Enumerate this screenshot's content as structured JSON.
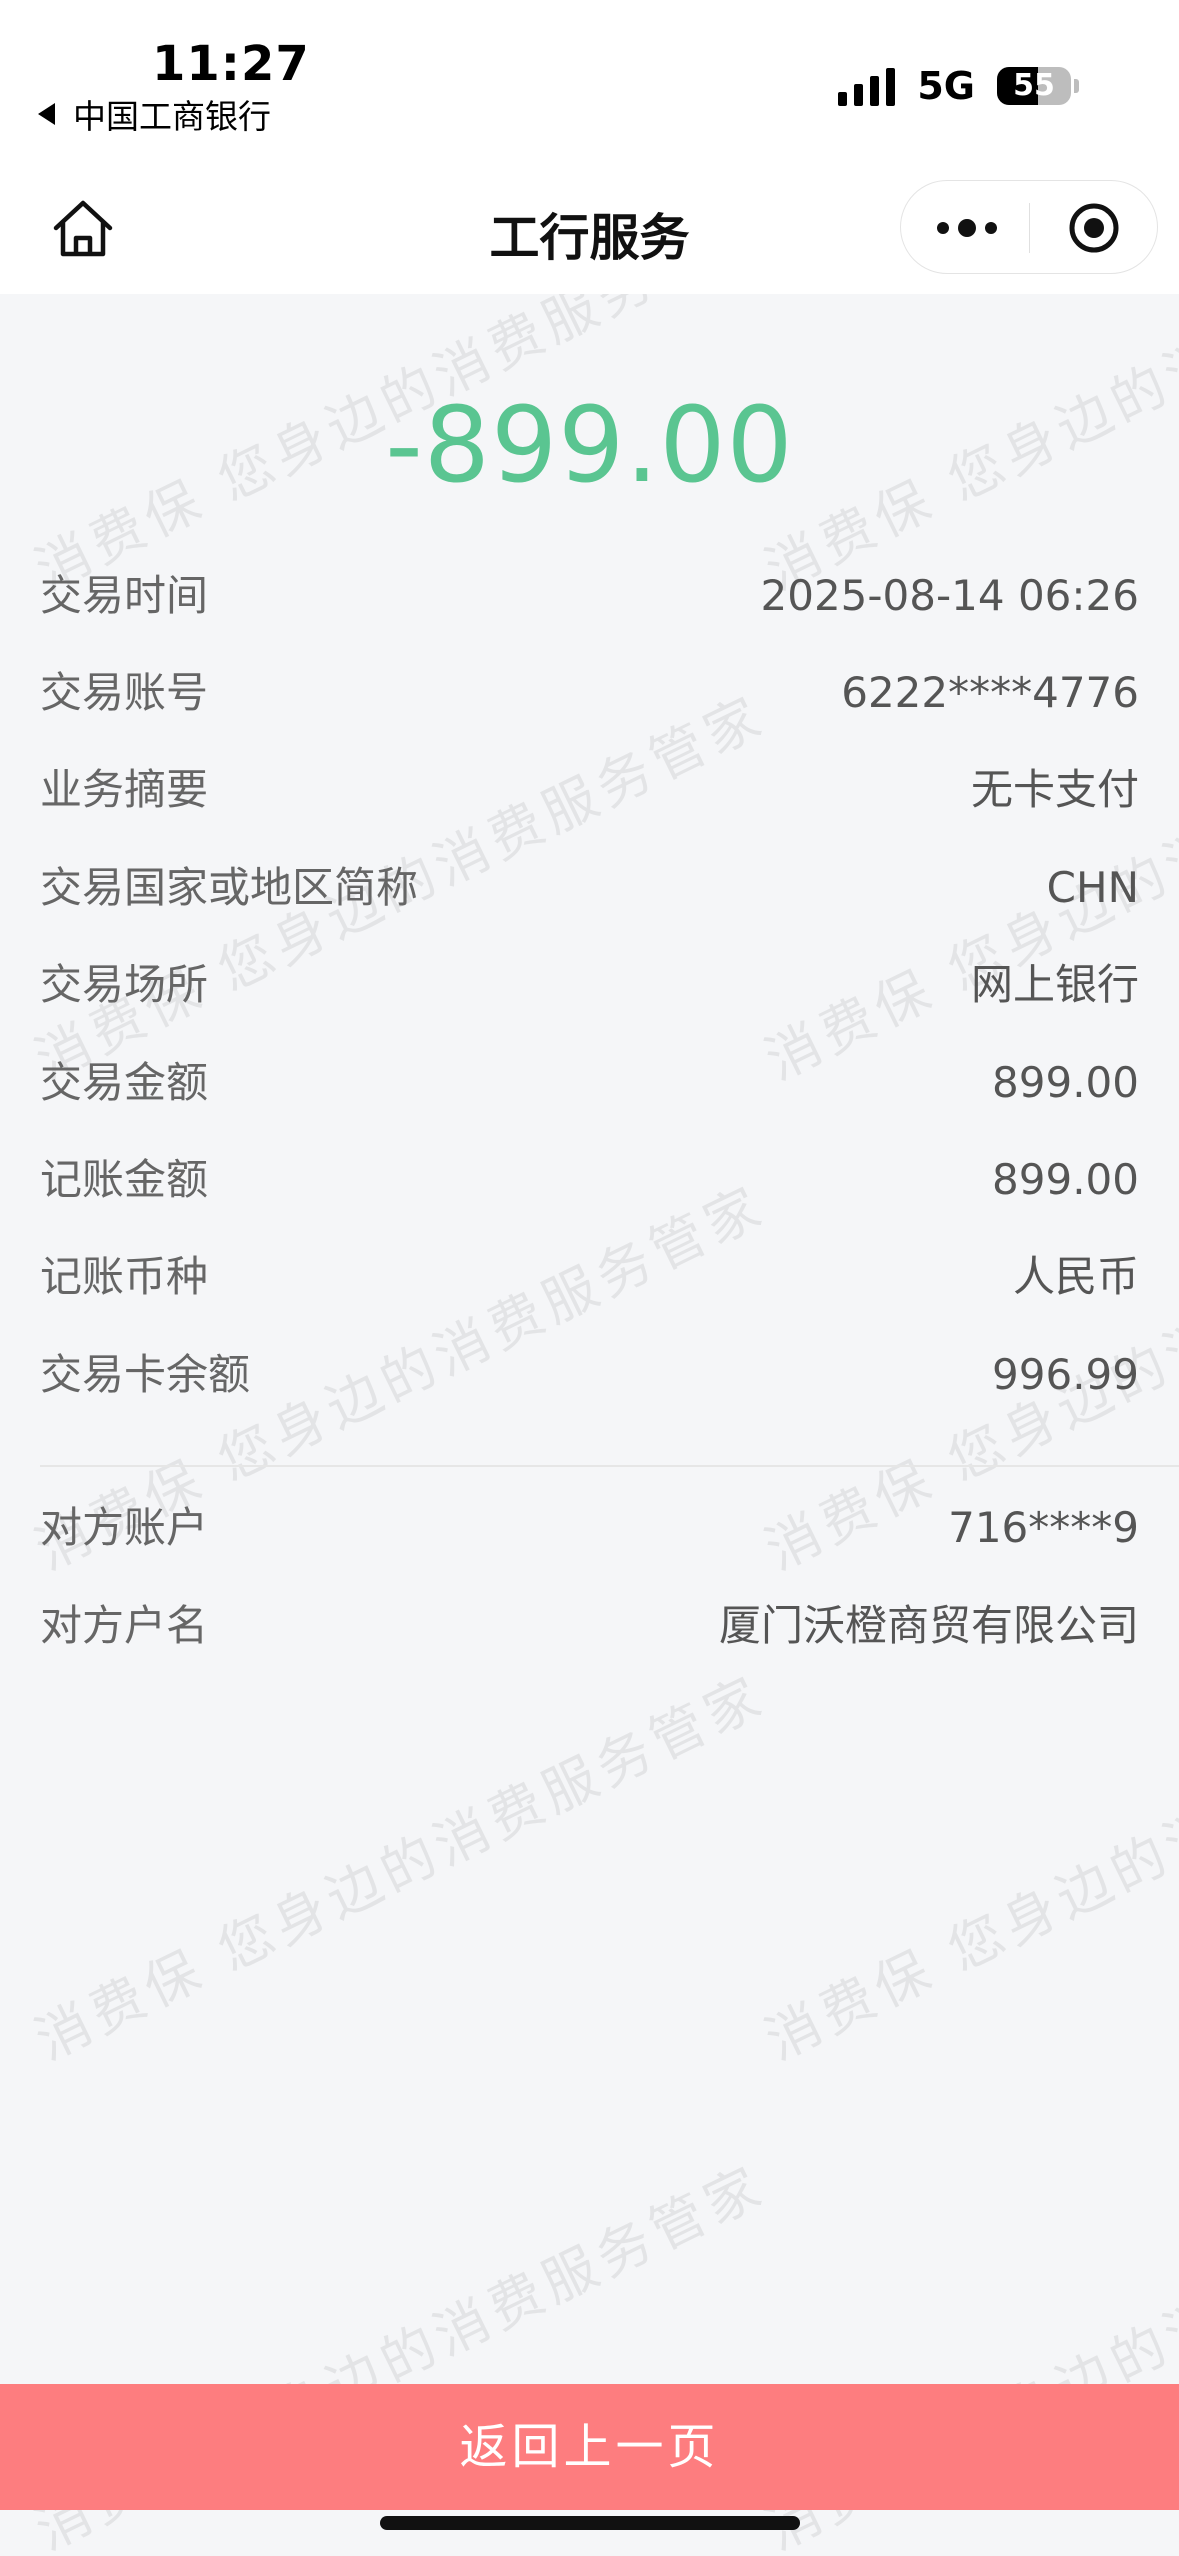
{
  "status_bar": {
    "time": "11:27",
    "back_app": "中国工商银行",
    "network": "5G",
    "battery": "55",
    "battery_level": 0.55
  },
  "nav": {
    "title": "工行服务",
    "home_icon": "home-icon",
    "more_icon": "more-dots-icon",
    "close_icon": "target-close-icon"
  },
  "transaction": {
    "amount": "-899.00",
    "amount_color": "#5ac591",
    "details": [
      {
        "label": "交易时间",
        "value": "2025-08-14 06:26"
      },
      {
        "label": "交易账号",
        "value": "6222****4776"
      },
      {
        "label": "业务摘要",
        "value": "无卡支付"
      },
      {
        "label": "交易国家或地区简称",
        "value": "CHN"
      },
      {
        "label": "交易场所",
        "value": "网上银行"
      },
      {
        "label": "交易金额",
        "value": "899.00"
      },
      {
        "label": "记账金额",
        "value": "899.00"
      },
      {
        "label": "记账币种",
        "value": "人民币"
      },
      {
        "label": "交易卡余额",
        "value": "996.99"
      }
    ],
    "counterparty": [
      {
        "label": "对方账户",
        "value": "716****9"
      },
      {
        "label": "对方户名",
        "value": "厦门沃橙商贸有限公司"
      }
    ]
  },
  "footer": {
    "back_label": "返回上一页",
    "button_color": "#fd7d7f"
  },
  "watermark": {
    "text": "消费保 您身边的消费服务管家"
  }
}
